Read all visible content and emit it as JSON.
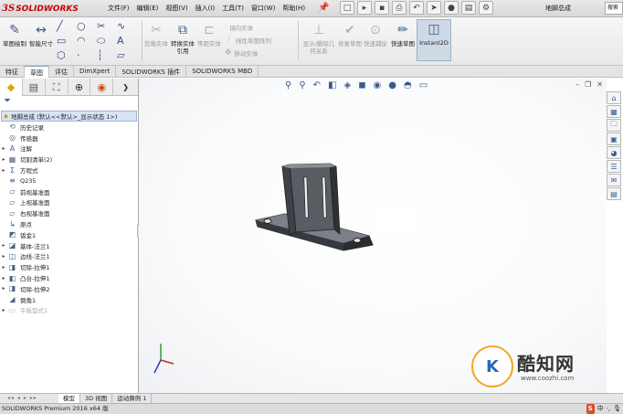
{
  "app": {
    "logo_ds": "3S",
    "logo_text": "SOLIDWORKS",
    "document_name": "地脚总成",
    "search_placeholder": "搜索"
  },
  "menu": [
    "文件(F)",
    "编辑(E)",
    "视图(V)",
    "插入(I)",
    "工具(T)",
    "窗口(W)",
    "帮助(H)"
  ],
  "ribbon": {
    "sketch": "草图绘制",
    "smart_dim": "智能尺寸",
    "convert": "转换实体引用",
    "offset_surface": "剪裁实体",
    "sketch_text": "等距实体",
    "mirror": "镜向实体",
    "linear_pattern": "线性草图阵列",
    "move": "移动实体",
    "display_relations": "显示/删除几何关系",
    "repair": "修复草图",
    "quick_snaps": "快速捕捉",
    "rapid_sketch": "快速草图",
    "instant2d": "Instant2D"
  },
  "tabs": [
    "特征",
    "草图",
    "评估",
    "DimXpert",
    "SOLIDWORKS 插件",
    "SOLIDWORKS MBD"
  ],
  "active_tab": 1,
  "tree": {
    "root_label": "地脚总成 (默认<<默认>_显示状态 1>)",
    "items": [
      {
        "label": "历史记录",
        "icon": "history-icon",
        "expand": false
      },
      {
        "label": "传感器",
        "icon": "sensor-icon",
        "expand": false
      },
      {
        "label": "注解",
        "icon": "annotation-icon",
        "expand": true
      },
      {
        "label": "切割清单(2)",
        "icon": "cut-list-icon",
        "expand": true
      },
      {
        "label": "方程式",
        "icon": "equation-icon",
        "expand": true
      },
      {
        "label": "Q235",
        "icon": "material-icon",
        "expand": false
      },
      {
        "label": "前视基准面",
        "icon": "plane-icon",
        "expand": false
      },
      {
        "label": "上视基准面",
        "icon": "plane-icon",
        "expand": false
      },
      {
        "label": "右视基准面",
        "icon": "plane-icon",
        "expand": false
      },
      {
        "label": "原点",
        "icon": "origin-icon",
        "expand": false
      },
      {
        "label": "钣金1",
        "icon": "sheet-metal-icon",
        "expand": false
      },
      {
        "label": "基体-法兰1",
        "icon": "base-flange-icon",
        "expand": true
      },
      {
        "label": "边线-法兰1",
        "icon": "edge-flange-icon",
        "expand": true
      },
      {
        "label": "切除-拉伸1",
        "icon": "cut-extrude-icon",
        "expand": true
      },
      {
        "label": "凸台-拉伸1",
        "icon": "boss-extrude-icon",
        "expand": true
      },
      {
        "label": "切除-拉伸2",
        "icon": "cut-extrude-icon",
        "expand": true
      },
      {
        "label": "倒角1",
        "icon": "chamfer-icon",
        "expand": false
      },
      {
        "label": "平板型式1",
        "icon": "flat-pattern-icon",
        "expand": true,
        "faded": true
      }
    ]
  },
  "bottom_tabs": [
    "模型",
    "3D 视图",
    "运动算例 1"
  ],
  "status": "SOLIDWORKS Premium 2016 x64 版",
  "watermark": {
    "logo": "K",
    "name": "酷知网",
    "url": "www.coozhi.com"
  },
  "tray": {
    "ime": "S",
    "lang": "中"
  },
  "colors": {
    "accent": "#3b5a8f",
    "selection": "#d6e4f5",
    "brand_red": "#cc0000"
  }
}
